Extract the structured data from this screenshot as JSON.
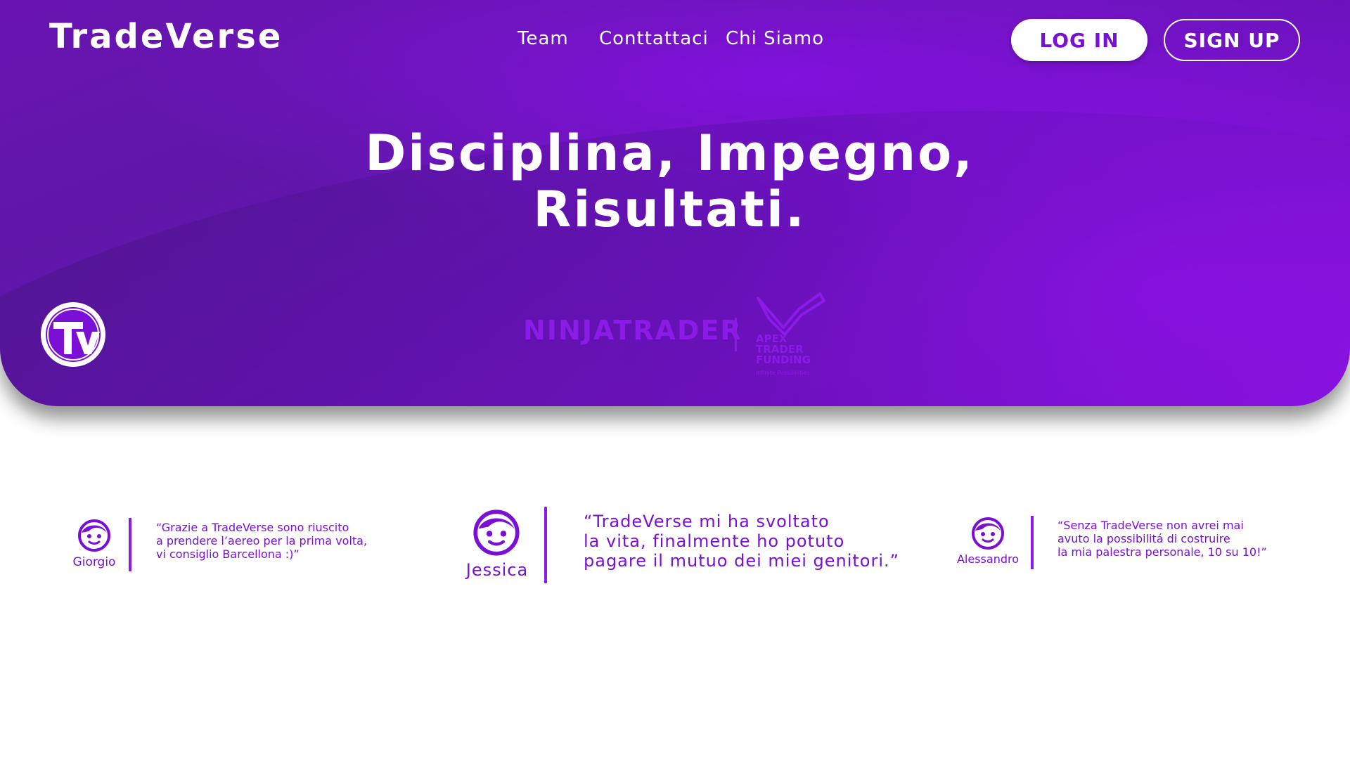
{
  "header": {
    "brand": "TradeVerse",
    "nav": [
      "Team",
      "Conttattaci",
      "Chi Siamo"
    ],
    "login_label": "LOG IN",
    "signup_label": "SIGN UP"
  },
  "hero": {
    "headline_line1": "Disciplina, Impegno,",
    "headline_line2": "Risultati.",
    "logo_icon": "tradeverse-tv-logo",
    "partners": {
      "ninjatrader": "NINJATRADER",
      "apex_line1": "APEX",
      "apex_line2": "TRADER",
      "apex_line3": "FUNDING",
      "apex_tagline": "Infinite Possibilities"
    }
  },
  "testimonials": [
    {
      "name": "Giorgio",
      "quote": "“Grazie a TradeVerse sono riuscito\na prendere l’aereo per la prima volta,\nvi consiglio Barcellona :)”",
      "icon": "face-icon"
    },
    {
      "name": "Jessica",
      "quote": "“TradeVerse mi ha svoltato\nla vita, finalmente ho potuto\npagare il mutuo dei miei genitori.”",
      "icon": "face-icon"
    },
    {
      "name": "Alessandro",
      "quote": "“Senza TradeVerse non avrei mai\navuto la possibilitá di costruire\nla mia palestra personale, 10 su 10!”",
      "icon": "face-icon"
    }
  ],
  "colors": {
    "accent": "#7a10d6",
    "hero_dark": "#5f17a8",
    "hero_light": "#8a10de",
    "white": "#ffffff"
  }
}
